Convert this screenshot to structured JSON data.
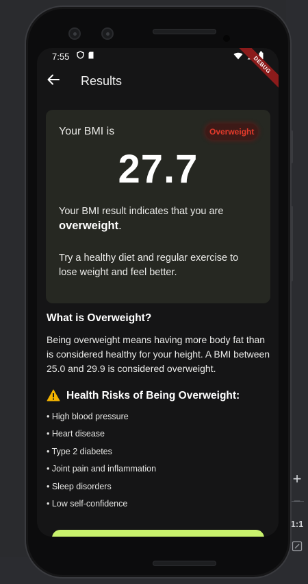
{
  "status_bar": {
    "time": "7:55",
    "left_icons": [
      "shield-icon",
      "sim-card-icon"
    ],
    "right_icons": [
      "wifi-icon",
      "signal-icon",
      "battery-icon"
    ],
    "debug_label": "DEBUG"
  },
  "app_bar": {
    "back_icon": "arrow-left-icon",
    "title": "Results"
  },
  "result_card": {
    "label": "Your BMI is",
    "badge": "Overweight",
    "bmi_value": "27.7",
    "result_line": "Your BMI result indicates that you are",
    "result_category": "overweight",
    "result_suffix": ".",
    "advice": "Try a healthy diet and regular exercise to lose weight and feel better."
  },
  "info": {
    "title": "What is Overweight?",
    "body": "Being overweight means having more body fat than is considered healthy for your height. A BMI between 25.0 and 29.9 is considered overweight."
  },
  "risks": {
    "icon": "warning-icon",
    "title": "Health Risks of Being Overweight:",
    "items": [
      "• High blood pressure",
      "• Heart disease",
      "• Type 2 diabetes",
      "• Joint pain and inflammation",
      "• Sleep disorders",
      "• Low self-confidence"
    ]
  },
  "emulator_controls": {
    "zoom_in": "+",
    "zoom_out": "−",
    "ratio": "1:1"
  },
  "colors": {
    "background": "#151516",
    "card": "#262822",
    "badge_text": "#e33a2b",
    "accent": "#c9f26d"
  }
}
